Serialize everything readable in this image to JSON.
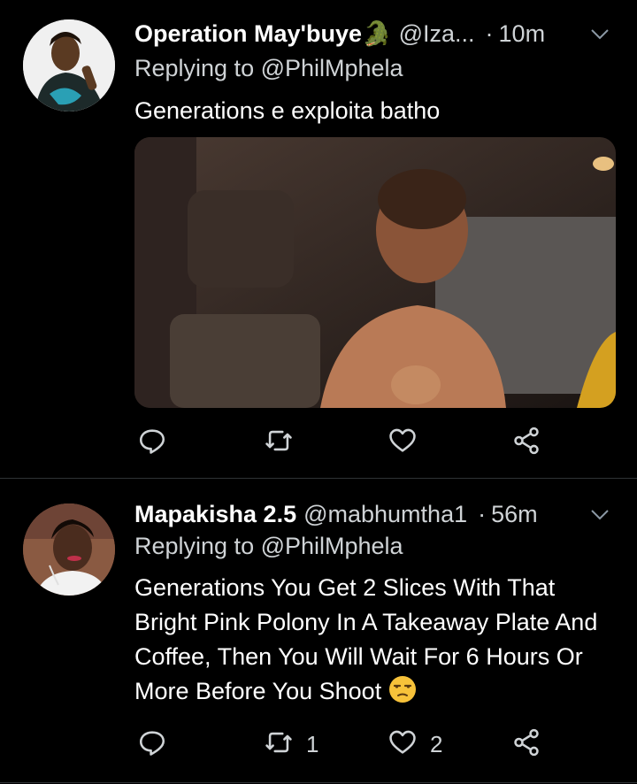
{
  "tweets": [
    {
      "name": "Operation May'buye🐊",
      "handle": "@Iza...",
      "dot": "·",
      "time": "10m",
      "replying_to": "Replying to @PhilMphela",
      "text": "Generations e exploita batho",
      "reply_count": "",
      "retweet_count": "",
      "like_count": ""
    },
    {
      "name": "Mapakisha 2.5",
      "handle": "@mabhumtha1",
      "dot": "·",
      "time": "56m",
      "replying_to": "Replying to @PhilMphela",
      "text": "Generations You Get 2 Slices With That Bright Pink Polony In A Takeaway Plate And Coffee, Then You Will Wait For 6 Hours Or More Before You Shoot",
      "reply_count": "",
      "retweet_count": "1",
      "like_count": "2"
    }
  ],
  "icons": {
    "reply": "reply-icon",
    "retweet": "retweet-icon",
    "like": "heart-icon",
    "share": "share-icon",
    "more": "chevron-down-icon",
    "emoji": "unamused-face-emoji"
  },
  "colors": {
    "background": "#000000",
    "text_primary": "#ffffff",
    "text_secondary": "#cfd3d6",
    "divider": "#2f3336"
  }
}
